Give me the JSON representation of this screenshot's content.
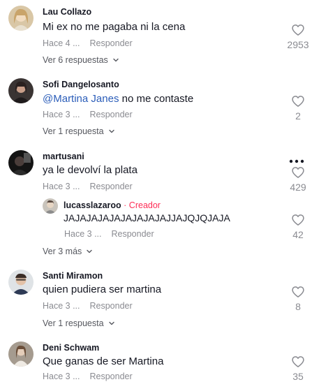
{
  "comments": [
    {
      "user": "Lau Collazo",
      "text": "Mi ex no me pagaba ni la cena",
      "time": "Hace 4 ...",
      "reply": "Responder",
      "likes": "2953",
      "replies": "Ver 6 respuestas"
    },
    {
      "user": "Sofi Dangelosanto",
      "mention": "@Martina Janes",
      "text": " no me contaste",
      "time": "Hace 3 ...",
      "reply": "Responder",
      "likes": "2",
      "replies": "Ver 1 respuesta"
    },
    {
      "user": "martusani",
      "text": "ya le devolví la plata",
      "time": "Hace 3 ...",
      "reply": "Responder",
      "likes": "429",
      "replies": "Ver 3 más"
    },
    {
      "user": "Santi Miramon",
      "text": "quien pudiera ser martina",
      "time": "Hace 3 ...",
      "reply": "Responder",
      "likes": "8",
      "replies": "Ver 1 respuesta"
    },
    {
      "user": "Deni Schwam",
      "text": "Que ganas de ser Martina",
      "time": "Hace 3 ...",
      "reply": "Responder",
      "likes": "35"
    }
  ],
  "nested_reply": {
    "user": "lucasslazaroo",
    "separator": " · ",
    "badge": "Creador",
    "text": "JAJAJAJAJAJAJAJAJAJJAJQJQJAJA",
    "time": "Hace 3 ...",
    "reply": "Responder",
    "likes": "42"
  },
  "icons": {
    "like": "heart-outline-icon",
    "more": "more-horizontal-icon",
    "expand": "chevron-down-icon"
  }
}
